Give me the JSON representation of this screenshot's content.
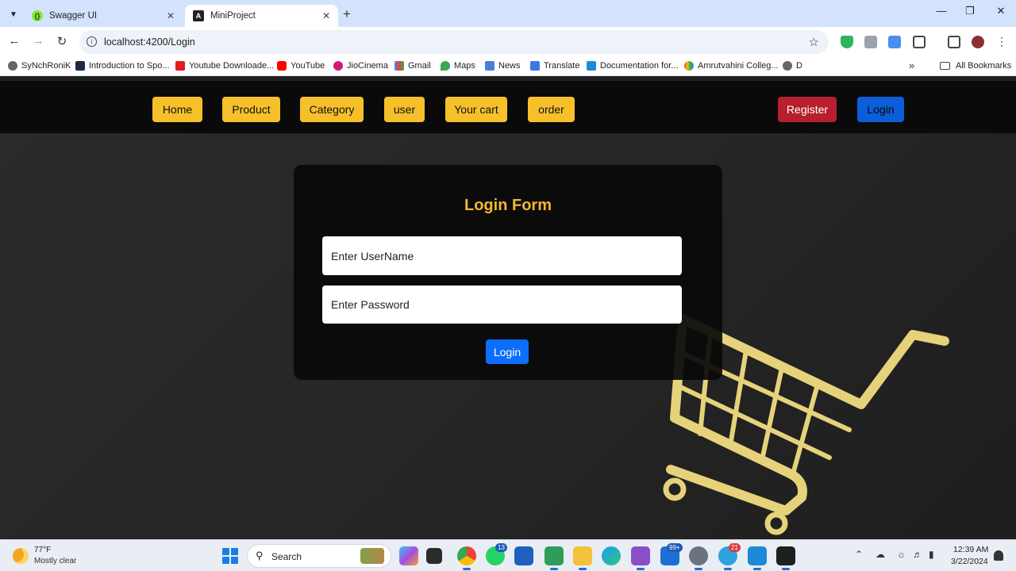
{
  "browser": {
    "tabs": [
      {
        "title": "Swagger UI",
        "favicon": "swagger-icon"
      },
      {
        "title": "MiniProject",
        "favicon": "angular-icon",
        "active": true
      }
    ],
    "url": "localhost:4200/Login",
    "bookmarks": [
      {
        "label": "SyNchRoniK"
      },
      {
        "label": "Introduction to Spo..."
      },
      {
        "label": "Youtube Downloade..."
      },
      {
        "label": "YouTube"
      },
      {
        "label": "JioCinema"
      },
      {
        "label": "Gmail"
      },
      {
        "label": "Maps"
      },
      {
        "label": "News"
      },
      {
        "label": "Translate"
      },
      {
        "label": "Documentation for..."
      },
      {
        "label": "Amrutvahini Colleg..."
      },
      {
        "label": "D"
      }
    ],
    "all_bookmarks": "All Bookmarks"
  },
  "nav": {
    "home": "Home",
    "product": "Product",
    "category": "Category",
    "user": "user",
    "cart": "Your cart",
    "order": "order",
    "register": "Register",
    "login": "Login"
  },
  "form": {
    "title": "Login Form",
    "username_placeholder": "Enter UserName",
    "password_placeholder": "Enter Password",
    "submit": "Login"
  },
  "taskbar": {
    "weather_temp": "77°F",
    "weather_desc": "Mostly clear",
    "search_label": "Search",
    "badge_whatsapp": "13",
    "badge_mail": "99+",
    "badge_telegram": "21",
    "time": "12:39 AM",
    "date": "3/22/2024"
  },
  "colors": {
    "accent_yellow": "#f6c02b",
    "register_red": "#b51f2e",
    "login_blue": "#0d6efd"
  }
}
